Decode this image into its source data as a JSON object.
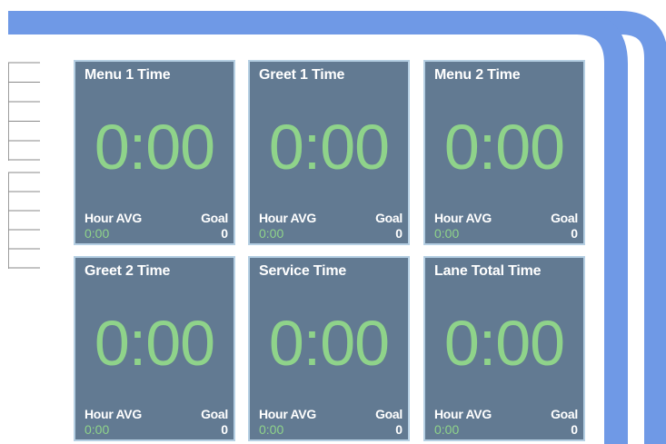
{
  "colors": {
    "lane": "#6f99e6",
    "card_bg": "#627a92",
    "card_border": "#b5cfe3",
    "timer_green": "#8fd38a",
    "label_white": "#ffffff"
  },
  "tiles": [
    {
      "title": "Menu 1 Time",
      "value": "0:00",
      "avg_label": "Hour AVG",
      "avg_value": "0:00",
      "goal_label": "Goal",
      "goal_value": "0"
    },
    {
      "title": "Greet 1 Time",
      "value": "0:00",
      "avg_label": "Hour AVG",
      "avg_value": "0:00",
      "goal_label": "Goal",
      "goal_value": "0"
    },
    {
      "title": "Menu 2 Time",
      "value": "0:00",
      "avg_label": "Hour AVG",
      "avg_value": "0:00",
      "goal_label": "Goal",
      "goal_value": "0"
    },
    {
      "title": "Greet 2 Time",
      "value": "0:00",
      "avg_label": "Hour AVG",
      "avg_value": "0:00",
      "goal_label": "Goal",
      "goal_value": "0"
    },
    {
      "title": "Service Time",
      "value": "0:00",
      "avg_label": "Hour AVG",
      "avg_value": "0:00",
      "goal_label": "Goal",
      "goal_value": "0"
    },
    {
      "title": "Lane Total Time",
      "value": "0:00",
      "avg_label": "Hour AVG",
      "avg_value": "0:00",
      "goal_label": "Goal",
      "goal_value": "0"
    }
  ]
}
